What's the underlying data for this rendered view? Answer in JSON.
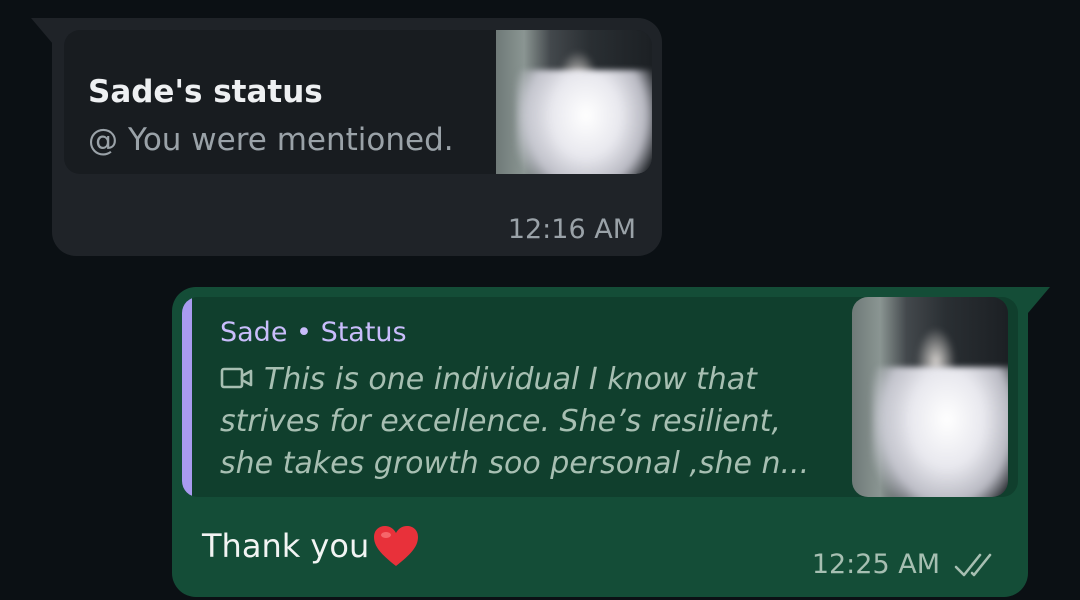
{
  "incoming": {
    "status_title": "Sade's status",
    "mention_icon": "at-icon",
    "mention_symbol": "@",
    "mention_text": "You were mentioned.",
    "time": "12:16 AM",
    "thumbnail": "blurred-bride-photo"
  },
  "outgoing": {
    "quote_author": "Sade",
    "quote_separator": "•",
    "quote_source": "Status",
    "quote_icon": "video-icon",
    "quote_lines": [
      "This is one individual I know that",
      "strives for excellence. She’s resilient,",
      "she takes growth soo personal ,she n..."
    ],
    "quote_thumbnail": "bride-photo",
    "message_text": "Thank you",
    "message_emoji": "heart-icon",
    "time": "12:25 AM",
    "read_receipt": "double-check-icon"
  },
  "colors": {
    "background": "#0b1014",
    "incoming_bubble": "#1f2328",
    "outgoing_bubble": "#144d37",
    "quote_accent": "#a99bf0",
    "quote_author_color": "#c9bdfb",
    "heart": "#e8313a"
  }
}
